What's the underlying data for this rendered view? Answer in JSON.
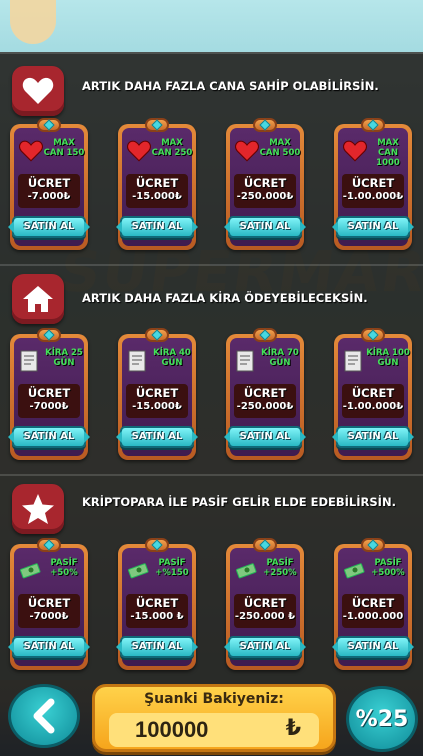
{
  "sections": [
    {
      "title": "ARTIK DAHA FAZLA CANA SAHİP OLABİLİRSİN.",
      "icon": "heart-icon",
      "items": [
        {
          "label": "MAX CAN 150",
          "price_label": "ÜCRET",
          "price": "-7.000₺",
          "buy": "SATIN AL",
          "icon": "heart-icon"
        },
        {
          "label": "MAX CAN 250",
          "price_label": "ÜCRET",
          "price": "-15.000₺",
          "buy": "SATIN AL",
          "icon": "heart-icon"
        },
        {
          "label": "MAX CAN 500",
          "price_label": "ÜCRET",
          "price": "-250.000₺",
          "buy": "SATIN AL",
          "icon": "heart-icon"
        },
        {
          "label": "MAX CAN 1000",
          "price_label": "ÜCRET",
          "price": "-1.00.000₺",
          "buy": "SATIN AL",
          "icon": "heart-icon"
        }
      ]
    },
    {
      "title": "ARTIK DAHA FAZLA KİRA ÖDEYEBİLECEKSİN.",
      "icon": "house-icon",
      "items": [
        {
          "label": "KİRA 25 GÜN",
          "price_label": "ÜCRET",
          "price": "-7000₺",
          "buy": "SATIN AL",
          "icon": "document-icon"
        },
        {
          "label": "KİRA 40 GÜN",
          "price_label": "ÜCRET",
          "price": "-15.000₺",
          "buy": "SATIN AL",
          "icon": "document-icon"
        },
        {
          "label": "KİRA 70 GÜN",
          "price_label": "ÜCRET",
          "price": "-250.000₺",
          "buy": "SATIN AL",
          "icon": "document-icon"
        },
        {
          "label": "KİRA 100 GÜN",
          "price_label": "ÜCRET",
          "price": "-1.00.000₺",
          "buy": "SATIN AL",
          "icon": "document-icon"
        }
      ]
    },
    {
      "title": "KRİPTOPARA İLE PASİF GELİR ELDE EDEBİLİRSİN.",
      "icon": "star-icon",
      "items": [
        {
          "label": "PASİF +50%",
          "price_label": "ÜCRET",
          "price": "-7000₺",
          "buy": "SATIN AL",
          "icon": "money-icon"
        },
        {
          "label": "PASİF +%150",
          "price_label": "ÜCRET",
          "price": "-15.000 ₺",
          "buy": "SATIN AL",
          "icon": "money-icon"
        },
        {
          "label": "PASİF +250%",
          "price_label": "ÜCRET",
          "price": "-250.000 ₺",
          "buy": "SATIN AL",
          "icon": "money-icon"
        },
        {
          "label": "PASİF +500%",
          "price_label": "ÜCRET",
          "price": "-1.000.000",
          "buy": "SATIN AL",
          "icon": "money-icon"
        }
      ]
    }
  ],
  "bottom": {
    "balance_label": "Şuanki Bakiyeniz:",
    "balance_value": "100000",
    "currency": "₺",
    "percent_button": "%25",
    "back_icon": "chevron-left-icon"
  },
  "background_text": "SUPERMARKET",
  "colors": {
    "accent_red": "#a8262e",
    "buy_button": "#2ab9c4",
    "label_green": "#44e25a",
    "balance_gold": "#ffd24a"
  }
}
